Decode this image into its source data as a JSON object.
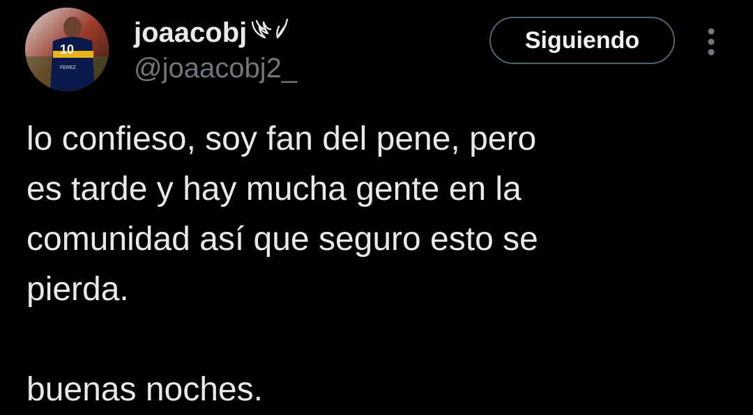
{
  "tweet": {
    "author": {
      "display_name": "joaacobj",
      "handle": "@joaacobj2_",
      "badge_icon": "wings-icon",
      "avatar_icon": "avatar-football-player"
    },
    "follow_button_label": "Siguiendo",
    "more_icon": "more-vertical-icon",
    "text_lines": [
      "lo confieso, soy fan del pene, pero",
      "es tarde y hay mucha gente en la",
      "comunidad así que seguro esto se",
      "pierda.",
      "",
      "buenas noches."
    ]
  },
  "colors": {
    "background": "#000000",
    "primary_text": "#e7e9ea",
    "secondary_text": "#71767b",
    "button_border": "#536471"
  }
}
